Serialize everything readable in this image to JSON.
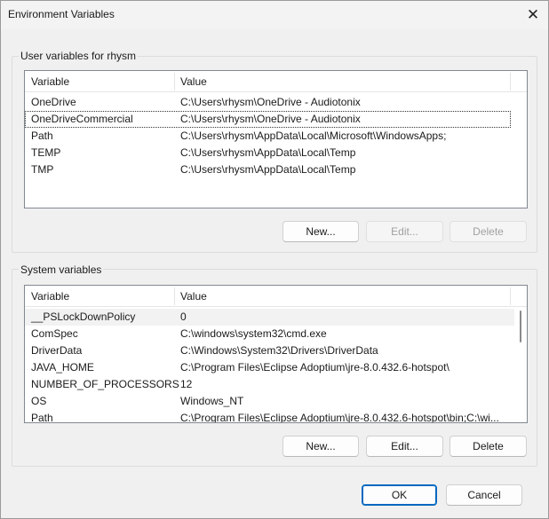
{
  "window": {
    "title": "Environment Variables"
  },
  "user_section": {
    "label": "User variables for rhysm",
    "columns": [
      "Variable",
      "Value"
    ],
    "rows": [
      {
        "name": "OneDrive",
        "value": "C:\\Users\\rhysm\\OneDrive - Audiotonix"
      },
      {
        "name": "OneDriveCommercial",
        "value": "C:\\Users\\rhysm\\OneDrive - Audiotonix"
      },
      {
        "name": "Path",
        "value": "C:\\Users\\rhysm\\AppData\\Local\\Microsoft\\WindowsApps;"
      },
      {
        "name": "TEMP",
        "value": "C:\\Users\\rhysm\\AppData\\Local\\Temp"
      },
      {
        "name": "TMP",
        "value": "C:\\Users\\rhysm\\AppData\\Local\\Temp"
      }
    ],
    "buttons": {
      "new": "New...",
      "edit": "Edit...",
      "delete": "Delete"
    }
  },
  "system_section": {
    "label": "System variables",
    "columns": [
      "Variable",
      "Value"
    ],
    "rows": [
      {
        "name": "__PSLockDownPolicy",
        "value": "0"
      },
      {
        "name": "ComSpec",
        "value": "C:\\windows\\system32\\cmd.exe"
      },
      {
        "name": "DriverData",
        "value": "C:\\Windows\\System32\\Drivers\\DriverData"
      },
      {
        "name": "JAVA_HOME",
        "value": "C:\\Program Files\\Eclipse Adoptium\\jre-8.0.432.6-hotspot\\"
      },
      {
        "name": "NUMBER_OF_PROCESSORS",
        "value": "12"
      },
      {
        "name": "OS",
        "value": "Windows_NT"
      },
      {
        "name": "Path",
        "value": "C:\\Program Files\\Eclipse Adoptium\\jre-8.0.432.6-hotspot\\bin;C:\\wi..."
      }
    ],
    "buttons": {
      "new": "New...",
      "edit": "Edit...",
      "delete": "Delete"
    }
  },
  "footer": {
    "ok": "OK",
    "cancel": "Cancel"
  },
  "icons": {
    "close": "close-icon"
  }
}
